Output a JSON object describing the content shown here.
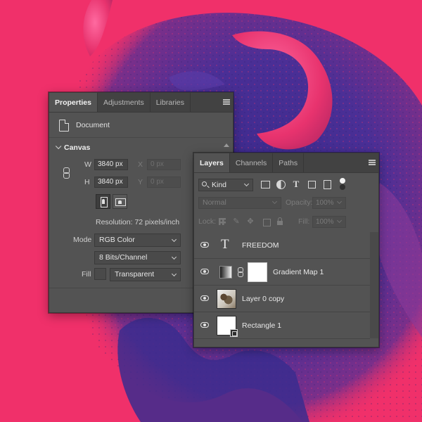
{
  "properties_panel": {
    "tabs": [
      {
        "label": "Properties",
        "active": true
      },
      {
        "label": "Adjustments",
        "active": false
      },
      {
        "label": "Libraries",
        "active": false
      }
    ],
    "document_label": "Document",
    "canvas_section_title": "Canvas",
    "width_label": "W",
    "width_value": "3840 px",
    "height_label": "H",
    "height_value": "3840 px",
    "x_label": "X",
    "x_placeholder": "0 px",
    "y_label": "Y",
    "y_placeholder": "0 px",
    "resolution_text": "Resolution: 72 pixels/inch",
    "mode_label": "Mode",
    "mode_value": "RGB Color",
    "bit_depth_value": "8 Bits/Channel",
    "fill_label": "Fill",
    "fill_value": "Transparent"
  },
  "layers_panel": {
    "tabs": [
      {
        "label": "Layers",
        "active": true
      },
      {
        "label": "Channels",
        "active": false
      },
      {
        "label": "Paths",
        "active": false
      }
    ],
    "filter_kind": "Kind",
    "blend_mode": "Normal",
    "opacity_label": "Opacity:",
    "opacity_value": "100%",
    "lock_label": "Lock:",
    "fill_label": "Fill:",
    "fill_value": "100%",
    "layers": [
      {
        "name": "FREEDOM",
        "kind": "type"
      },
      {
        "name": "Gradient Map 1",
        "kind": "adjustment"
      },
      {
        "name": "Layer 0 copy",
        "kind": "photo"
      },
      {
        "name": "Rectangle 1",
        "kind": "shape"
      }
    ]
  },
  "colors": {
    "background_magenta": "#f0306a",
    "duotone_indigo": "#3a2a8c",
    "panel_bg": "#535353",
    "tab_bar_bg": "#424242"
  }
}
